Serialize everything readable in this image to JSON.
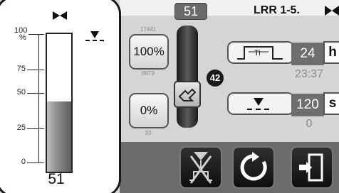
{
  "level_panel": {
    "scale_unit": "%",
    "tick_labels": [
      "100",
      "75",
      "50",
      "25",
      "0"
    ],
    "level_percent": 51,
    "level_value": "51",
    "icons": [
      "valve-icon",
      "level-symbol-icon"
    ]
  },
  "header": {
    "top_value": "51",
    "device_label": "LRR 1-5."
  },
  "controls": {
    "btn_100": "100%",
    "btn_0": "0%",
    "num_top": "17441",
    "num_mid": "8979",
    "num_bot": "33",
    "badge": "42"
  },
  "params": {
    "ti_value": "24",
    "ti_unit": "h",
    "ti_sub": "23:37",
    "level_time_value": "120",
    "level_time_unit": "s",
    "level_time_sub": "0"
  },
  "nav": {
    "icons": [
      "manual-valve-icon",
      "refresh-icon",
      "exit-door-icon"
    ]
  },
  "colors": {
    "panel_border": "#1a1a1a",
    "accent_dark": "#6e6e6e",
    "background": "#d9d9d9"
  }
}
